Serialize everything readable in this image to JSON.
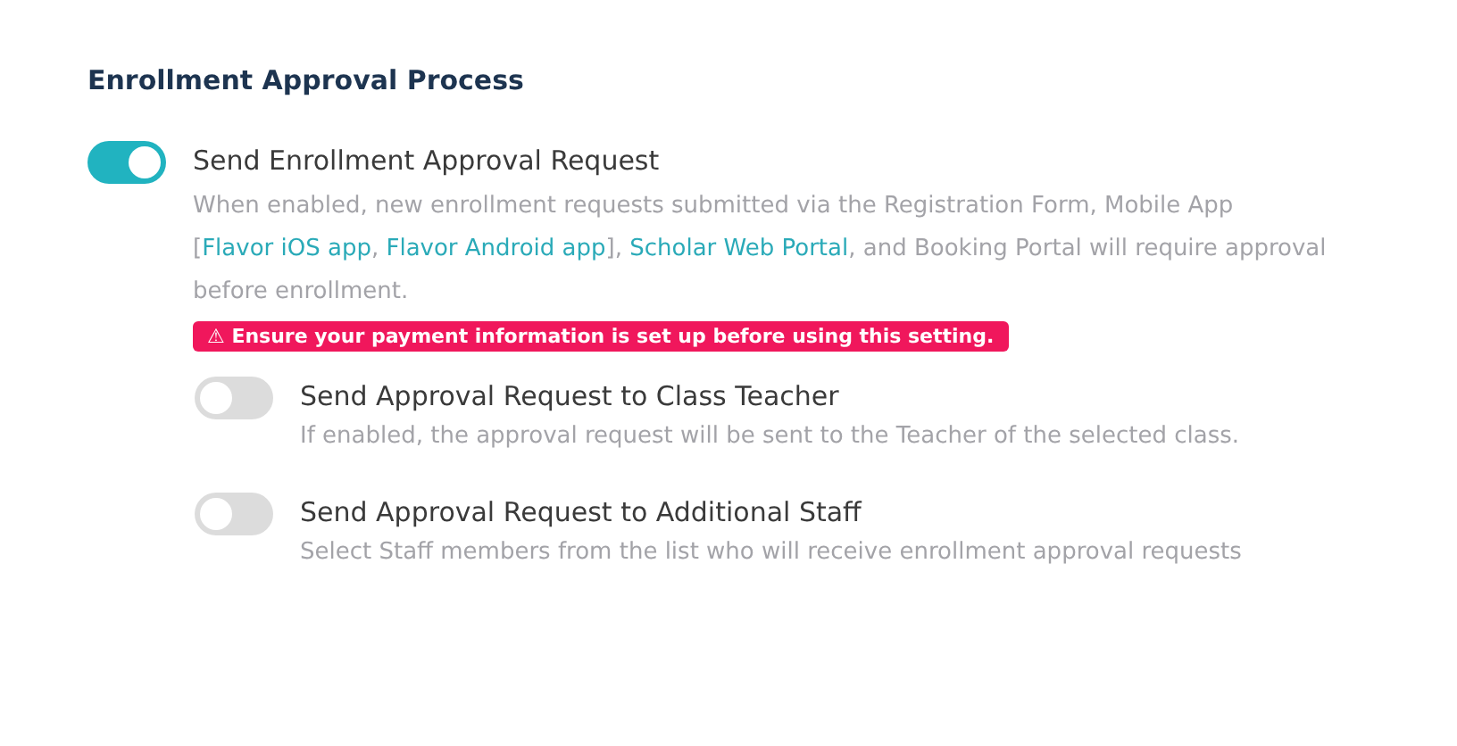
{
  "section": {
    "title": "Enrollment Approval Process"
  },
  "setting": {
    "title": "Send Enrollment Approval Request",
    "on": true,
    "description": [
      {
        "kind": "text",
        "text": "When enabled, new enrollment requests submitted via the Registration Form, Mobile App ["
      },
      {
        "kind": "link",
        "text": "Flavor iOS app"
      },
      {
        "kind": "text",
        "text": ", "
      },
      {
        "kind": "link",
        "text": "Flavor Android app"
      },
      {
        "kind": "text",
        "text": "], "
      },
      {
        "kind": "link",
        "text": "Scholar Web Portal"
      },
      {
        "kind": "text",
        "text": ", and Booking Portal will require approval before enrollment."
      }
    ],
    "warning": {
      "icon": "⚠",
      "text": "Ensure your payment information is set up before using this setting."
    },
    "children": [
      {
        "title": "Send Approval Request to Class Teacher",
        "on": false,
        "description": "If enabled, the approval request will be sent to the Teacher of the selected class."
      },
      {
        "title": "Send Approval Request to Additional Staff",
        "on": false,
        "description": "Select Staff members from the list who will receive enrollment approval requests"
      }
    ]
  }
}
